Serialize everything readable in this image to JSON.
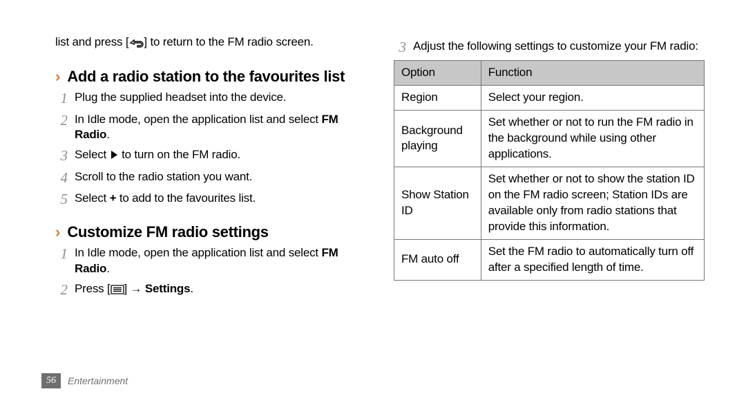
{
  "left": {
    "intro_pre": "list and press [",
    "intro_post": "] to return to the FM radio screen.",
    "section1_title": "Add a radio station to the favourites list",
    "s1_step1": "Plug the supplied headset into the device.",
    "s1_step2_pre": "In Idle mode, open the application list and select ",
    "s1_step2_bold1": "FM Radio",
    "s1_step2_post": ".",
    "s1_step3_pre": "Select ",
    "s1_step3_post": " to turn on the FM radio.",
    "s1_step4": "Scroll to the radio station you want.",
    "s1_step5_pre": "Select ",
    "s1_step5_bold": "+",
    "s1_step5_post": " to add to the favourites list.",
    "section2_title": "Customize FM radio settings",
    "s2_step1_pre": "In Idle mode, open the application list and select ",
    "s2_step1_bold1": "FM Radio",
    "s2_step1_post": ".",
    "s2_step2_pre": "Press [",
    "s2_step2_mid": "] → ",
    "s2_step2_bold": "Settings",
    "s2_step2_post": "."
  },
  "right": {
    "step3": "Adjust the following settings to customize your FM radio:",
    "th_option": "Option",
    "th_function": "Function",
    "rows": {
      "r1o": "Region",
      "r1f": "Select your region.",
      "r2o": "Background playing",
      "r2f": "Set whether or not to run the FM radio in the background while using other applications.",
      "r3o": "Show Station ID",
      "r3f": "Set whether or not to show the station ID on the FM radio screen; Station IDs are available only from radio stations that provide this information.",
      "r4o": "FM auto off",
      "r4f": "Set the FM radio to automatically turn off after a specified length of time."
    }
  },
  "nums": {
    "n1": "1",
    "n2": "2",
    "n3": "3",
    "n4": "4",
    "n5": "5"
  },
  "footer": {
    "page": "56",
    "section": "Entertainment"
  }
}
